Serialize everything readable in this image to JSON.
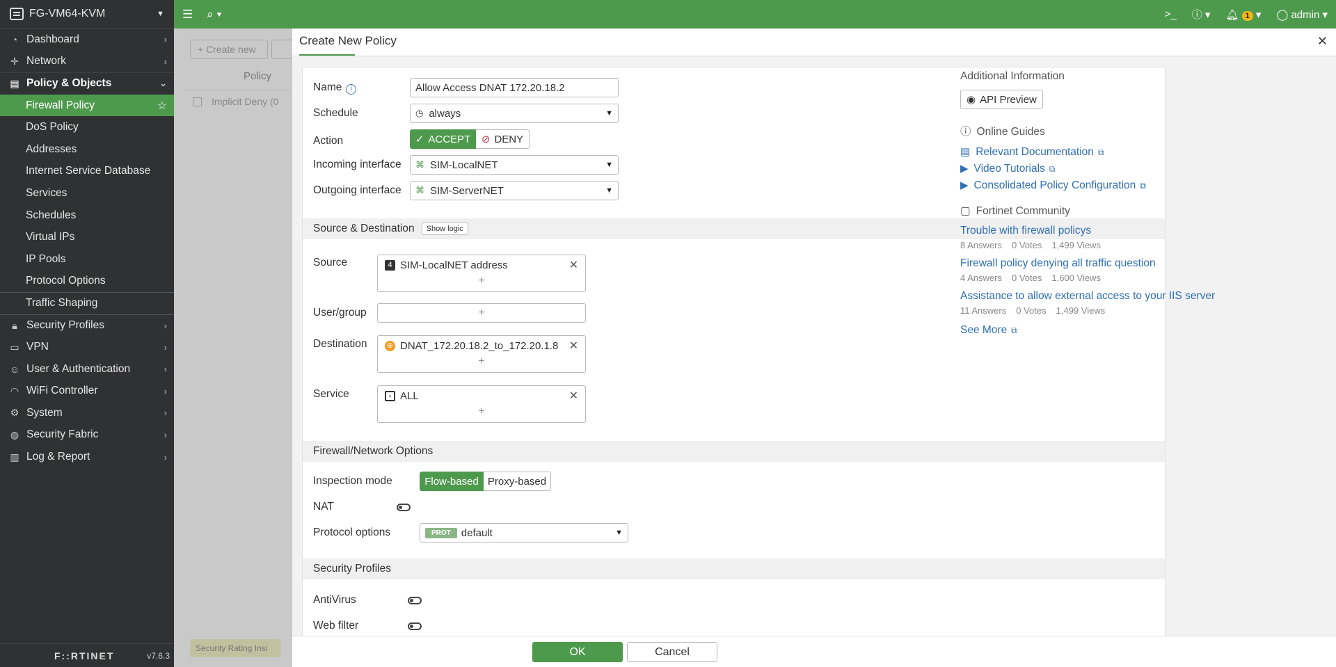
{
  "sidebar": {
    "device_name": "FG-VM64-KVM",
    "items": [
      {
        "label": "Dashboard",
        "icon": "dashboard-icon"
      },
      {
        "label": "Network",
        "icon": "network-icon"
      },
      {
        "label": "Policy & Objects",
        "icon": "policy-icon"
      },
      {
        "label": "Firewall Policy"
      },
      {
        "label": "DoS Policy"
      },
      {
        "label": "Addresses"
      },
      {
        "label": "Internet Service Database"
      },
      {
        "label": "Services"
      },
      {
        "label": "Schedules"
      },
      {
        "label": "Virtual IPs"
      },
      {
        "label": "IP Pools"
      },
      {
        "label": "Protocol Options"
      },
      {
        "label": "Traffic Shaping"
      },
      {
        "label": "Security Profiles",
        "icon": "lock-icon"
      },
      {
        "label": "VPN",
        "icon": "laptop-icon"
      },
      {
        "label": "User & Authentication",
        "icon": "user-icon"
      },
      {
        "label": "WiFi Controller",
        "icon": "wifi-icon"
      },
      {
        "label": "System",
        "icon": "gear-icon"
      },
      {
        "label": "Security Fabric",
        "icon": "fabric-icon"
      },
      {
        "label": "Log & Report",
        "icon": "log-icon"
      }
    ],
    "logo": "F::RTINET",
    "version": "v7.6.3"
  },
  "topbar": {
    "notifications_count": "1",
    "user": "admin"
  },
  "background": {
    "create_new": "+ Create new",
    "column_policy": "Policy",
    "row_implicit": "Implicit Deny (0",
    "security_rating": "Security Rating Insi"
  },
  "modal": {
    "title": "Create New Policy",
    "name_label": "Name",
    "name_value": "Allow Access DNAT 172.20.18.2",
    "schedule_label": "Schedule",
    "schedule_value": "always",
    "action_label": "Action",
    "accept_label": "ACCEPT",
    "deny_label": "DENY",
    "incoming_label": "Incoming interface",
    "incoming_value": "SIM-LocalNET",
    "outgoing_label": "Outgoing interface",
    "outgoing_value": "SIM-ServerNET",
    "section_src_dst": "Source & Destination",
    "show_logic": "Show logic",
    "source_label": "Source",
    "source_value": "SIM-LocalNET address",
    "user_group_label": "User/group",
    "destination_label": "Destination",
    "destination_value": "DNAT_172.20.18.2_to_172.20.1.8",
    "service_label": "Service",
    "service_value": "ALL",
    "section_fw": "Firewall/Network Options",
    "inspection_label": "Inspection mode",
    "flow_based": "Flow-based",
    "proxy_based": "Proxy-based",
    "nat_label": "NAT",
    "protocol_label": "Protocol options",
    "prot_badge": "PROT",
    "protocol_value": "default",
    "section_sec": "Security Profiles",
    "antivirus_label": "AntiVirus",
    "webfilter_label": "Web filter",
    "ok": "OK",
    "cancel": "Cancel"
  },
  "info": {
    "heading": "Additional Information",
    "api_preview": "API Preview",
    "guides_heading": "Online Guides",
    "guides": [
      "Relevant Documentation",
      "Video Tutorials",
      "Consolidated Policy Configuration"
    ],
    "community_heading": "Fortinet Community",
    "posts": [
      {
        "title": "Trouble with firewall policys",
        "answers": "8 Answers",
        "votes": "0 Votes",
        "views": "1,499 Views"
      },
      {
        "title": "Firewall policy denying all traffic question",
        "answers": "4 Answers",
        "votes": "0 Votes",
        "views": "1,600 Views"
      },
      {
        "title": "Assistance to allow external access to your IIS server",
        "answers": "11 Answers",
        "votes": "0 Votes",
        "views": "1,499 Views"
      }
    ],
    "see_more": "See More"
  }
}
